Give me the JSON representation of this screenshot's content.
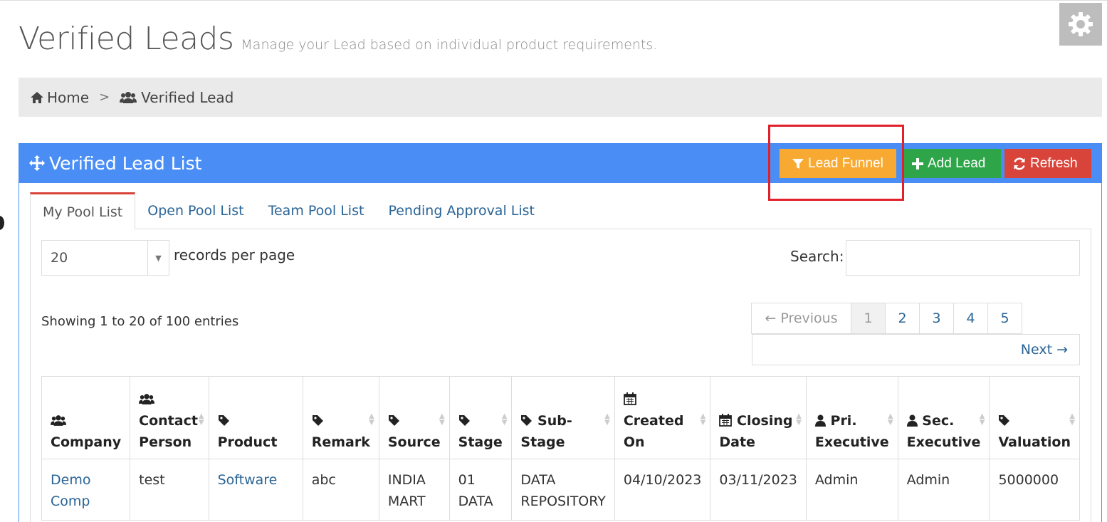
{
  "page": {
    "title": "Verified Leads",
    "subtitle": "Manage your Lead based on individual product requirements."
  },
  "breadcrumb": {
    "home": "Home",
    "separator": ">",
    "current": "Verified Lead"
  },
  "panel": {
    "title": "Verified Lead List",
    "buttons": {
      "lead_funnel": "Lead Funnel",
      "add_lead": "Add Lead",
      "refresh": "Refresh"
    }
  },
  "tabs": [
    "My Pool List",
    "Open Pool List",
    "Team Pool List",
    "Pending Approval List"
  ],
  "list_controls": {
    "page_length": "20",
    "page_length_label": "records per page",
    "search_label": "Search:",
    "search_value": ""
  },
  "info": "Showing 1 to 20 of 100 entries",
  "pagination": {
    "previous": "← Previous",
    "pages": [
      "1",
      "2",
      "3",
      "4",
      "5"
    ],
    "next": "Next →"
  },
  "table": {
    "columns": [
      {
        "line1": "",
        "line2": "Company",
        "icon": "users-icon"
      },
      {
        "line1": "Contact",
        "line2": "Person",
        "icon": "users-icon"
      },
      {
        "line1": "",
        "line2": "Product",
        "icon": "tag-icon"
      },
      {
        "line1": "",
        "line2": "Remark",
        "icon": "tag-icon"
      },
      {
        "line1": "",
        "line2": "Source",
        "icon": "tag-icon"
      },
      {
        "line1": "",
        "line2": "Stage",
        "icon": "tag-icon"
      },
      {
        "line1": "Sub-",
        "line2": "Stage",
        "icon": "tag-icon"
      },
      {
        "line1": "Created",
        "line2": "On",
        "icon": "calendar-icon"
      },
      {
        "line1": "Closing",
        "line2": "Date",
        "icon": "calendar-icon"
      },
      {
        "line1": "Pri.",
        "line2": "Executive",
        "icon": "user-icon"
      },
      {
        "line1": "Sec.",
        "line2": "Executive",
        "icon": "user-icon"
      },
      {
        "line1": "",
        "line2": "Valuation",
        "icon": "tag-icon"
      }
    ],
    "rows": [
      [
        "Demo Comp",
        "test",
        "Software",
        "abc",
        "INDIA MART",
        "01 DATA",
        "DATA REPOSITORY",
        "04/10/2023",
        "03/11/2023",
        "Admin",
        "Admin",
        "5000000"
      ]
    ]
  },
  "colors": {
    "panel_header": "#4a8ef5",
    "funnel_button": "#f8a932",
    "add_button": "#2ea548",
    "refresh_button": "#d9443a",
    "highlight_box": "#e0202a"
  }
}
